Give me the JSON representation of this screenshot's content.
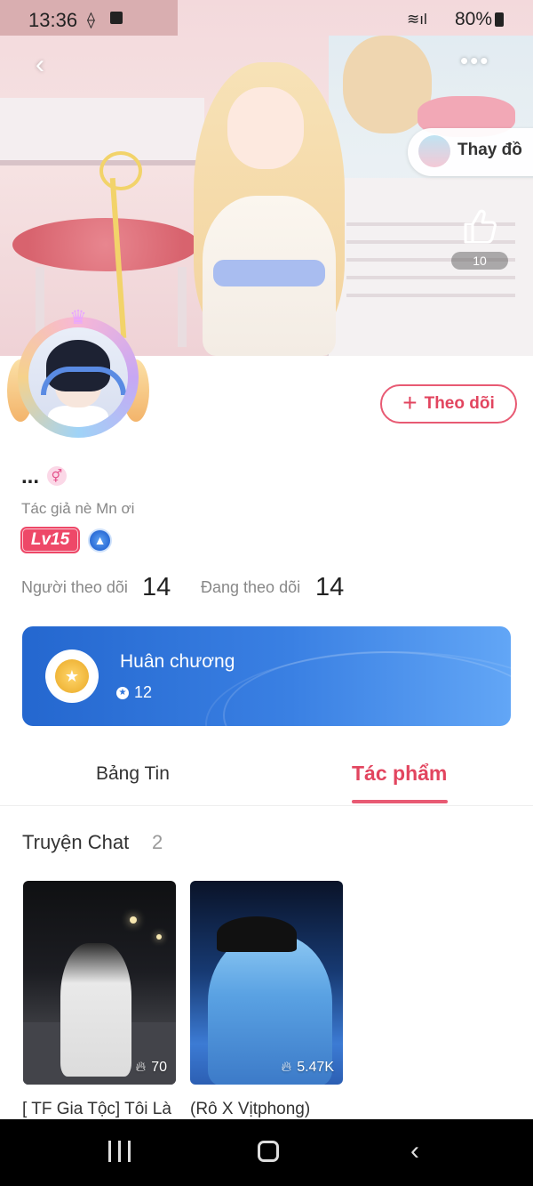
{
  "status_bar": {
    "time": "13:36",
    "battery": "80%"
  },
  "banner": {
    "change_outfit_label": "Thay đồ",
    "like_count": "10"
  },
  "profile": {
    "follow_button": "Theo dõi",
    "username": "...",
    "bio": "Tác giả nè Mn ơi",
    "level": "Lv15",
    "followers_label": "Người theo dõi",
    "followers_count": "14",
    "following_label": "Đang theo dõi",
    "following_count": "14"
  },
  "medal": {
    "title": "Huân chương",
    "count": "12"
  },
  "tabs": [
    {
      "label": "Bảng Tin",
      "active": false
    },
    {
      "label": "Tác phẩm",
      "active": true
    }
  ],
  "section": {
    "title": "Truyện Chat",
    "count": "2",
    "stories": [
      {
        "title": "[ TF Gia Tộc] Tôi Là",
        "views": "70"
      },
      {
        "title": "(Rô X Vịtphong)",
        "views": "5.47K"
      }
    ]
  },
  "colors": {
    "accent": "#e85a73",
    "medal_card_start": "#2467cf",
    "medal_card_end": "#62a6f6",
    "level_badge": "#ee4868"
  },
  "icons": {
    "back": "chevron-left-icon",
    "more": "more-horizontal-icon",
    "like": "thumbs-up-icon",
    "gender": "gender-icon",
    "rank": "rank-icon",
    "medal": "medal-icon",
    "views": "fire-icon"
  }
}
